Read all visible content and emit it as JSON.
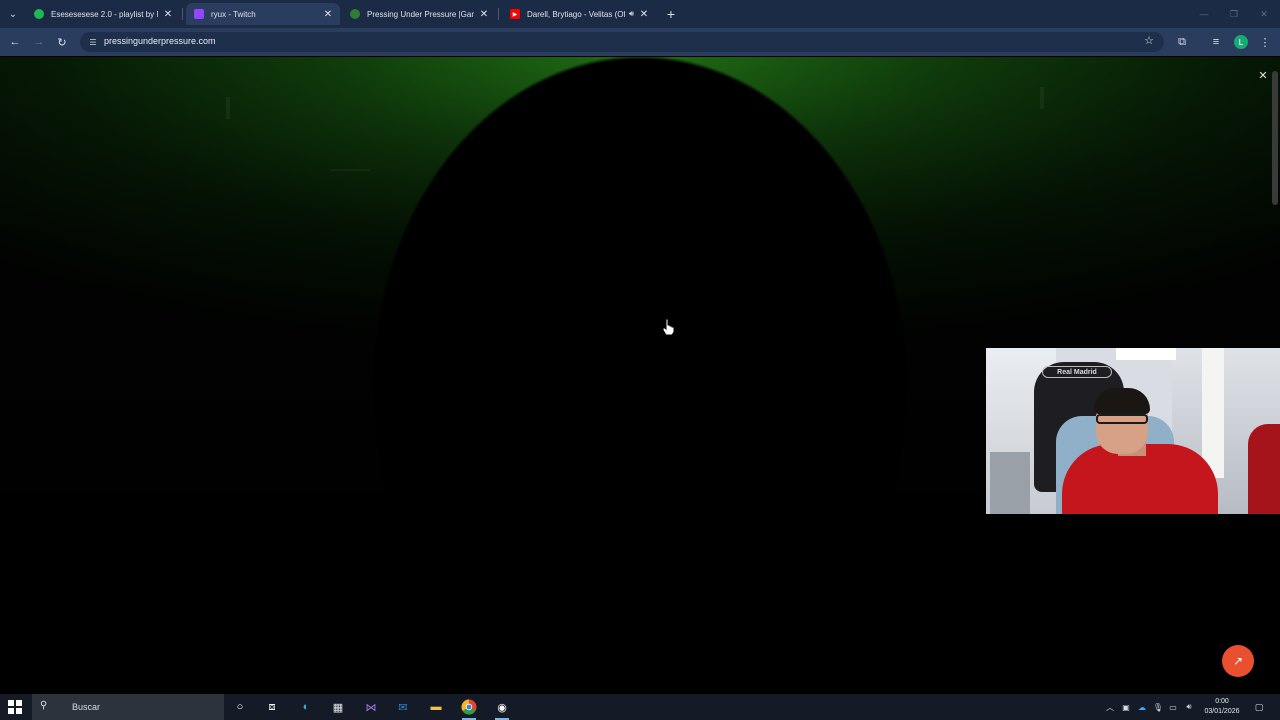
{
  "browser": {
    "tabs": [
      {
        "title": "Esesesesese 2.0 - playlist by Na",
        "favicon": "spotify-icon",
        "color": "#1db954",
        "active": false
      },
      {
        "title": "ryux - Twitch",
        "favicon": "twitch-icon",
        "color": "#9146ff",
        "active": true
      },
      {
        "title": "Pressing Under Pressure |Game",
        "favicon": "game-icon",
        "color": "#2e7d32",
        "active": false
      },
      {
        "title": "Darell, Brytiago - Velitas (Of",
        "favicon": "youtube-icon",
        "color": "#ff0000",
        "active": false
      }
    ],
    "address": {
      "url": "pressingunderpressure.com"
    },
    "profile_initial": "L"
  },
  "page": {
    "accent_green": "#1f6d14",
    "share_color": "#e8502f",
    "webcam_jersey_text": "Real Madrid"
  },
  "taskbar": {
    "search_placeholder": "Buscar",
    "apps": [
      "cortana-icon",
      "task-view-icon",
      "edge-icon",
      "store-icon",
      "visual-studio-icon",
      "mail-icon",
      "file-explorer-icon",
      "chrome-icon",
      "obs-icon"
    ],
    "clock": {
      "time": "0:00",
      "date": "03/01/2026"
    }
  }
}
